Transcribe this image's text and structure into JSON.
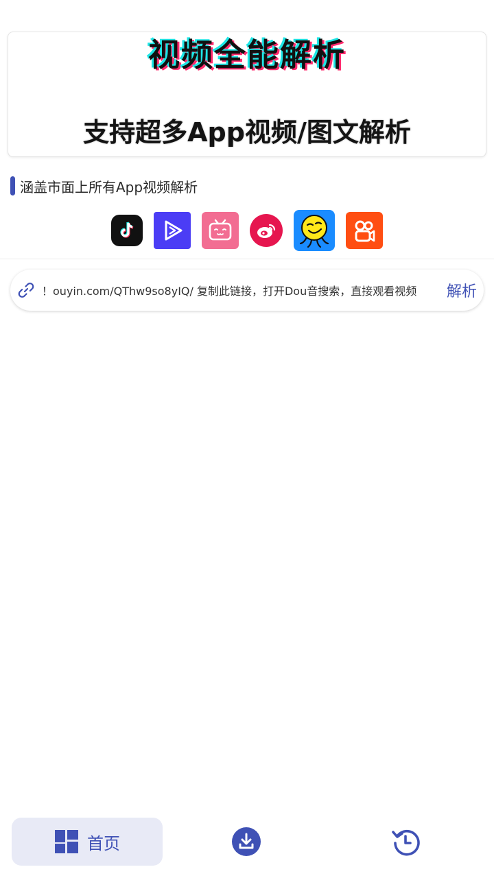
{
  "banner": {
    "title": "视频全能解析",
    "subtitle": "支持超多App视频/图文解析"
  },
  "section": {
    "heading": "涵盖市面上所有App视频解析"
  },
  "apps": [
    {
      "name": "douyin-icon",
      "color": "#111111"
    },
    {
      "name": "video-play-icon",
      "color": "#4b3df5"
    },
    {
      "name": "bilibili-icon",
      "color": "#f26d92"
    },
    {
      "name": "weibo-icon",
      "color": "#e6164f"
    },
    {
      "name": "pipixia-icon",
      "color": "#1a8cff"
    },
    {
      "name": "kuaishou-icon",
      "color": "#ff4e12"
    }
  ],
  "link": {
    "value": "ouyin.com/QThw9so8yIQ/ 复制此链接，打开Dou音搜索，直接观看视频！",
    "parse_label": "解析"
  },
  "nav": {
    "home_label": "首页"
  },
  "colors": {
    "accent": "#3f51b5",
    "nav_active_bg": "#e8eaf6"
  }
}
